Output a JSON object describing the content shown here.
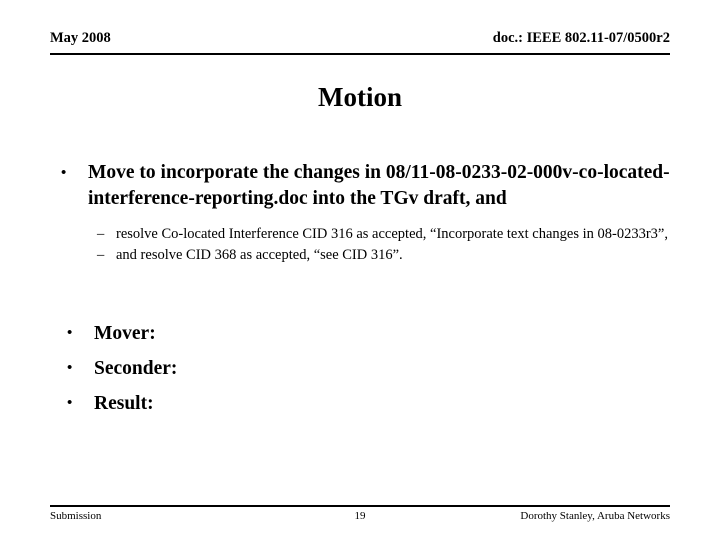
{
  "header": {
    "date": "May 2008",
    "doc_id": "doc.: IEEE 802.11-07/0500r2"
  },
  "title": "Motion",
  "content": {
    "bullet_marker": "•",
    "dash_marker": "–",
    "main_bullet": "Move to incorporate the changes in 08/11-08-0233-02-000v-co-located-interference-reporting.doc  into the TGv draft, and",
    "sub_bullets": [
      "resolve Co-located Interference CID 316 as accepted, “Incorporate text changes in 08-0233r3”,",
      "and resolve CID 368 as accepted, “see CID 316”."
    ],
    "motion_fields": [
      "Mover:",
      "Seconder:",
      "Result:"
    ]
  },
  "footer": {
    "left": "Submission",
    "page_number": "19",
    "right": "Dorothy Stanley, Aruba Networks"
  },
  "colors": {
    "text": "#000000",
    "background": "#ffffff",
    "rule": "#000000"
  }
}
